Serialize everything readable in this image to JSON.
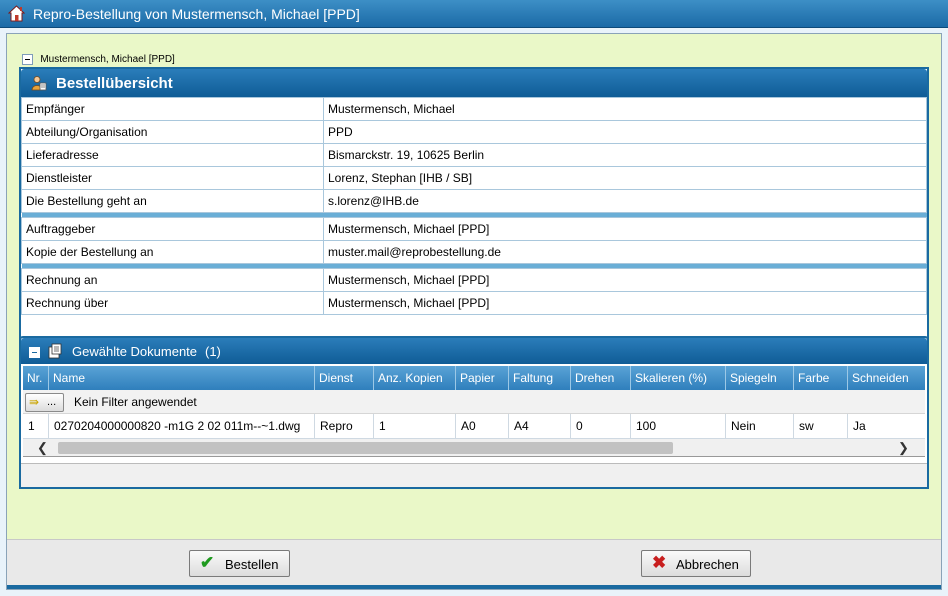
{
  "window": {
    "title": "Repro-Bestellung von Mustermensch, Michael [PPD]"
  },
  "tree": {
    "node_label": "Mustermensch, Michael [PPD]"
  },
  "overview": {
    "title": "Bestellübersicht",
    "rows": [
      {
        "label": "Empfänger",
        "value": "Mustermensch, Michael"
      },
      {
        "label": "Abteilung/Organisation",
        "value": "PPD"
      },
      {
        "label": "Lieferadresse",
        "value": "Bismarckstr. 19, 10625 Berlin"
      },
      {
        "label": "Dienstleister",
        "value": "Lorenz, Stephan [IHB / SB]"
      },
      {
        "label": "Die Bestellung geht an",
        "value": "s.lorenz@IHB.de"
      },
      {
        "label": "Auftraggeber",
        "value": "Mustermensch, Michael [PPD]"
      },
      {
        "label": "Kopie der Bestellung an",
        "value": "muster.mail@reprobestellung.de"
      },
      {
        "label": "Rechnung an",
        "value": "Mustermensch, Michael [PPD]"
      },
      {
        "label": "Rechnung über",
        "value": "Mustermensch, Michael [PPD]"
      }
    ]
  },
  "documents": {
    "title": "Gewählte Dokumente",
    "count": "(1)",
    "columns": [
      "Nr.",
      "Name",
      "Dienst",
      "Anz. Kopien",
      "Papier",
      "Faltung",
      "Drehen",
      "Skalieren (%)",
      "Spiegeln",
      "Farbe",
      "Schneiden"
    ],
    "filter_button": "...",
    "filter_text": "Kein Filter angewendet",
    "rows": [
      [
        "1",
        "0270204000000820 -m1G 2 02 011m--~1.dwg",
        "Repro",
        "1",
        "A0",
        "A4",
        "0",
        "100",
        "Nein",
        "sw",
        "Ja"
      ]
    ],
    "scroll_left": "❮",
    "scroll_right": "❯"
  },
  "actions": {
    "order_label": "Bestellen",
    "order_icon": "check-icon",
    "cancel_label": "Abbrechen",
    "cancel_icon": "cross-icon"
  },
  "colors": {
    "accent": "#1a6aa0",
    "background": "#eaf8c8",
    "header_gradient_top": "#2b7dba"
  }
}
